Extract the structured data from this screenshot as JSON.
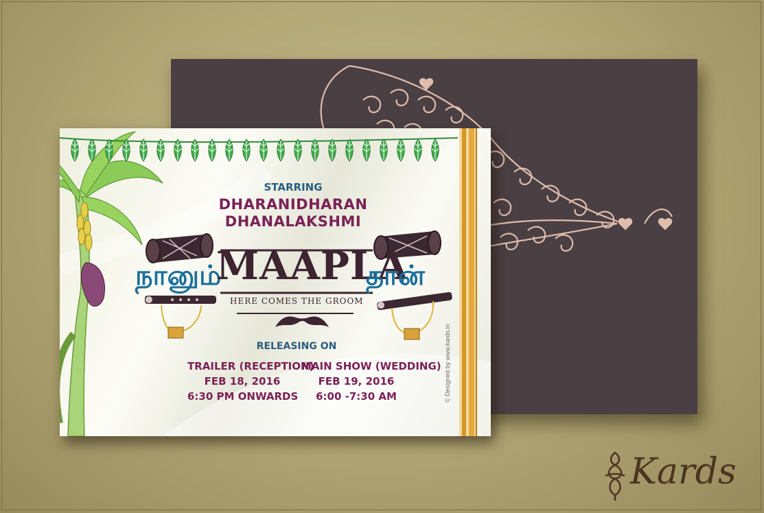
{
  "card": {
    "starring_label": "STARRING",
    "groom_name": "DHARANIDHARAN",
    "bride_name": "DHANALAKSHMI",
    "tamil_left": "நானும்",
    "tamil_right": "தான்",
    "title": "MAAPLA",
    "tagline": "HERE COMES THE GROOM",
    "releasing_label": "RELEASING ON",
    "events": [
      {
        "title": "TRAILER (RECEPTION)",
        "date": "FEB 18, 2016",
        "time": "6:30 PM ONWARDS"
      },
      {
        "title": "MAIN SHOW (WEDDING)",
        "date": "FEB 19, 2016",
        "time": "6:00 -7:30 AM"
      }
    ],
    "credit": "© Designed by www.kards.in"
  },
  "brand": {
    "name": "Kards"
  },
  "colors": {
    "background": "#b1a574",
    "back_card": "#4a3f43",
    "ornament": "#e6c4b3",
    "blue_text": "#2a5d7e",
    "purple_text": "#7a2156",
    "title_text": "#3d2430",
    "tamil_text": "#1b6f9b",
    "gold_stripe": "#d9a23a"
  },
  "icons": [
    "mango-leaf-garland-icon",
    "banana-tree-icon",
    "drum-icon",
    "flute-icon",
    "mustache-icon",
    "ornament-icon",
    "brand-mark-icon"
  ]
}
